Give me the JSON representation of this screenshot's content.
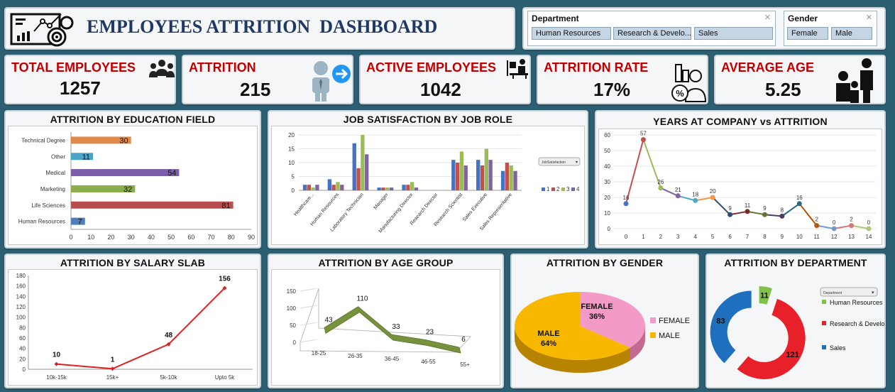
{
  "header": {
    "title": "EMPLOYEES ATTRITION  DASHBOARD",
    "logo_icon": "dashboard-analytics-icon"
  },
  "slicers": {
    "department": {
      "title": "Department",
      "items": [
        "Human Resources",
        "Research & Develo...",
        "Sales"
      ]
    },
    "gender": {
      "title": "Gender",
      "items": [
        "Female",
        "Male"
      ]
    }
  },
  "kpis": [
    {
      "label": "TOTAL EMPLOYEES",
      "value": "1257",
      "icon": "people-group-icon"
    },
    {
      "label": "ATTRITION",
      "value": "215",
      "icon": "employee-exit-icon"
    },
    {
      "label": "ACTIVE EMPLOYEES",
      "value": "1042",
      "icon": "employee-at-desk-icon"
    },
    {
      "label": "ATTRITION RATE",
      "value": "17%",
      "icon": "rate-chart-person-icon"
    },
    {
      "label": "AVERAGE AGE",
      "value": "5.25",
      "icon": "family-silhouette-icon"
    }
  ],
  "colors": {
    "label_red": "#c00000",
    "title_navy": "#1f3864",
    "background": "#2d5f73"
  },
  "chart_data": [
    {
      "id": "education",
      "type": "bar",
      "orientation": "horizontal",
      "title": "ATTRITION BY EDUCATION FIELD",
      "categories": [
        "Technical Degree",
        "Other",
        "Medical",
        "Marketing",
        "Life Sciences",
        "Human Resources"
      ],
      "values": [
        30,
        11,
        54,
        32,
        81,
        7
      ],
      "colors": [
        "#e0894a",
        "#4aa3c8",
        "#7b5ea7",
        "#8cad4b",
        "#b84f4f",
        "#4f7fb8"
      ],
      "xticks": [
        0,
        10,
        20,
        30,
        40,
        50,
        60,
        70,
        80,
        90
      ],
      "xlim": [
        0,
        90
      ]
    },
    {
      "id": "jobsat",
      "type": "bar",
      "title": "JOB SATISFACTION BY JOB ROLE",
      "categories": [
        "Healthcare...",
        "Human Resources",
        "Laboratory Technician",
        "Manager",
        "Manufacturing Director",
        "Research Director",
        "Research Scientist",
        "Sales Executive",
        "Sales Representative"
      ],
      "series": [
        {
          "name": "1",
          "color": "#4472c4",
          "values": [
            2,
            4,
            17,
            1,
            2,
            0,
            11,
            11,
            7
          ]
        },
        {
          "name": "2",
          "color": "#c0504d",
          "values": [
            2,
            2,
            8,
            1,
            2,
            0,
            10,
            9,
            10
          ]
        },
        {
          "name": "3",
          "color": "#9bbb59",
          "values": [
            1,
            3,
            20,
            1,
            3,
            0,
            14,
            15,
            9
          ]
        },
        {
          "name": "4",
          "color": "#8064a2",
          "values": [
            2,
            2,
            13,
            1,
            1,
            0,
            9,
            11,
            7
          ]
        }
      ],
      "yticks": [
        0,
        5,
        10,
        15,
        20
      ],
      "ylim": [
        0,
        20
      ],
      "filter_label": "JobSatisfaction"
    },
    {
      "id": "years",
      "type": "line",
      "title": "YEARS AT COMPANY vs ATTRITION",
      "x": [
        0,
        1,
        2,
        3,
        4,
        5,
        6,
        7,
        8,
        9,
        10,
        11,
        12,
        13,
        14
      ],
      "values": [
        16,
        57,
        26,
        21,
        18,
        20,
        9,
        11,
        9,
        8,
        16,
        2,
        0,
        2,
        0
      ],
      "colors": [
        "#4472c4",
        "#c0504d",
        "#9bbb59",
        "#8064a2",
        "#4bacc6",
        "#f79646",
        "#2c4d75",
        "#772c2a",
        "#5f7530",
        "#4d3b62",
        "#276a7c",
        "#b65708",
        "#729aca",
        "#cd7b79",
        "#afc97a"
      ],
      "yticks": [
        0,
        10,
        20,
        30,
        40,
        50,
        60
      ],
      "ylim": [
        0,
        60
      ]
    },
    {
      "id": "salary",
      "type": "line",
      "title": "ATTRITION BY SALARY SLAB",
      "categories": [
        "10k-15k",
        "15k+",
        "5k-10k",
        "Upto 5k"
      ],
      "values": [
        10,
        1,
        48,
        156
      ],
      "color": "#e02020",
      "yticks": [
        0,
        20,
        40,
        60,
        80,
        100,
        120,
        140,
        160,
        180
      ],
      "ylim": [
        0,
        180
      ]
    },
    {
      "id": "age",
      "type": "line",
      "title": "ATTRITION BY AGE GROUP",
      "categories": [
        "18-25",
        "26-35",
        "36-45",
        "46-55",
        "55+"
      ],
      "values": [
        43,
        110,
        33,
        23,
        6
      ],
      "color": "#76923c",
      "yticks": [
        0,
        50,
        100,
        150
      ],
      "ylim": [
        0,
        150
      ]
    },
    {
      "id": "gender",
      "type": "pie",
      "title": "ATTRITION BY GENDER",
      "labels": [
        "FEMALE",
        "MALE"
      ],
      "percent_labels": [
        "36%",
        "64%"
      ],
      "values": [
        36,
        64
      ],
      "colors": [
        "#f49ac6",
        "#f8b800"
      ]
    },
    {
      "id": "department",
      "type": "pie",
      "style": "donut",
      "title": "ATTRITION BY DEPARTMENT",
      "labels": [
        "Human Resources",
        "Research & Development",
        "Sales"
      ],
      "values": [
        11,
        121,
        83
      ],
      "colors": [
        "#7fbf4a",
        "#e8202a",
        "#1f6fbf"
      ],
      "filter_label": "Department"
    }
  ]
}
